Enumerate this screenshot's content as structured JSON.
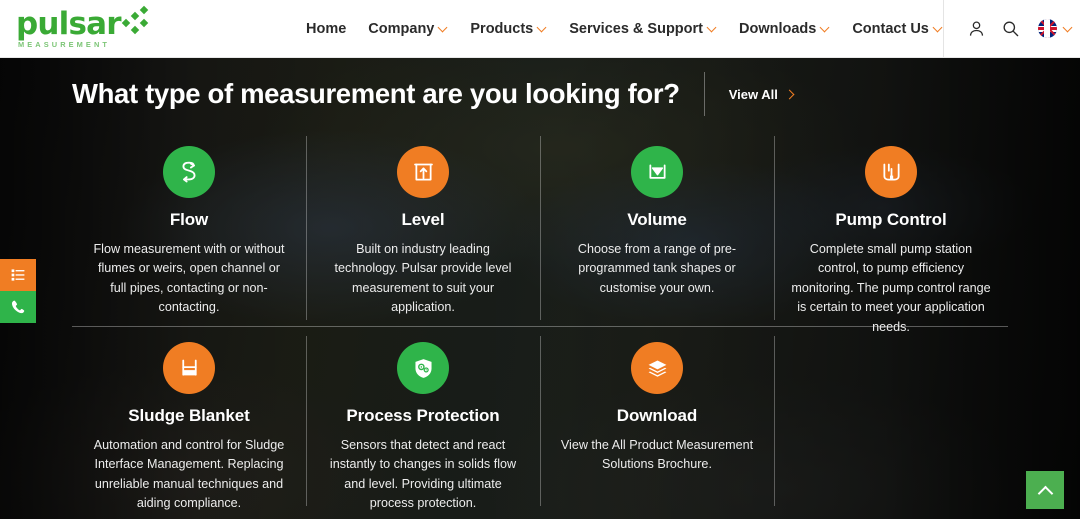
{
  "header": {
    "logo": {
      "word": "pulsar",
      "subtitle": "MEASUREMENT",
      "color": "#3aaa35"
    },
    "nav": [
      {
        "label": "Home",
        "has_dropdown": false
      },
      {
        "label": "Company",
        "has_dropdown": true
      },
      {
        "label": "Products",
        "has_dropdown": true
      },
      {
        "label": "Services & Support",
        "has_dropdown": true
      },
      {
        "label": "Downloads",
        "has_dropdown": true
      },
      {
        "label": "Contact Us",
        "has_dropdown": true
      }
    ],
    "tools": {
      "account_icon": "user-icon",
      "search_icon": "search-icon",
      "language_flag": "uk-flag-icon",
      "language_chevron": "chevron-down-icon"
    }
  },
  "hero": {
    "title": "What type of measurement are you looking for?",
    "view_all_label": "View All",
    "view_all_icon": "chevron-right-icon"
  },
  "cards": [
    {
      "title": "Flow",
      "desc": "Flow measurement with or without flumes or weirs, open channel or full pipes, contacting or non-contacting.",
      "icon": "flow-icon",
      "color": "#2fb44a"
    },
    {
      "title": "Level",
      "desc": "Built on industry leading technology. Pulsar provide level measurement to suit your application.",
      "icon": "level-icon",
      "color": "#f07d23"
    },
    {
      "title": "Volume",
      "desc": "Choose from a range of pre-programmed tank shapes or customise your own.",
      "icon": "volume-icon",
      "color": "#2fb44a"
    },
    {
      "title": "Pump Control",
      "desc": "Complete small pump station control, to pump efficiency monitoring. The pump control range is certain to meet your application needs.",
      "icon": "pump-control-icon",
      "color": "#f07d23"
    },
    {
      "title": "Sludge Blanket",
      "desc": "Automation and control for Sludge Interface Management. Replacing unreliable manual techniques and aiding compliance.",
      "icon": "sludge-blanket-icon",
      "color": "#f07d23"
    },
    {
      "title": "Process Protection",
      "desc": "Sensors that detect and react instantly to changes in solids flow and level. Providing ultimate process protection.",
      "icon": "process-protection-icon",
      "color": "#2fb44a"
    },
    {
      "title": "Download",
      "desc": "View the All Product Measurement Solutions Brochure.",
      "icon": "download-layers-icon",
      "color": "#f07d23"
    }
  ],
  "side_tabs": [
    {
      "icon": "list-menu-icon",
      "color": "#f07d23"
    },
    {
      "icon": "phone-icon",
      "color": "#2fb44a"
    }
  ],
  "back_to_top": {
    "icon": "chevron-up-icon",
    "color": "#4caf50"
  }
}
